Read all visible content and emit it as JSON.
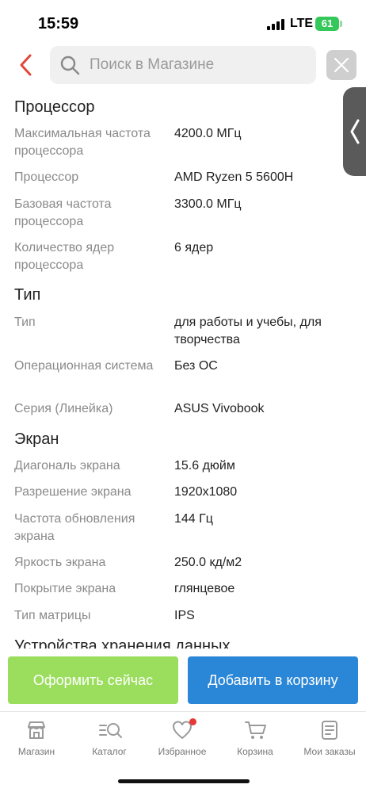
{
  "status_bar": {
    "time": "15:59",
    "network": "LTE",
    "battery": "61"
  },
  "search": {
    "placeholder": "Поиск в Магазине"
  },
  "sections": [
    {
      "title": "Процессор",
      "rows": [
        {
          "label": "Максимальная частота процессора",
          "value": "4200.0 МГц"
        },
        {
          "label": "Процессор",
          "value": "AMD Ryzen 5 5600H"
        },
        {
          "label": "Базовая частота процессора",
          "value": "3300.0 МГц"
        },
        {
          "label": "Количество ядер процессора",
          "value": "6 ядер"
        }
      ]
    },
    {
      "title": "Тип",
      "rows": [
        {
          "label": "Тип",
          "value": "для работы и учебы, для творчества"
        },
        {
          "label": "Операционная система",
          "value": "Без ОС"
        },
        {
          "label": "Серия (Линейка)",
          "value": "ASUS Vivobook"
        }
      ]
    },
    {
      "title": "Экран",
      "rows": [
        {
          "label": "Диагональ экрана",
          "value": "15.6 дюйм"
        },
        {
          "label": "Разрешение экрана",
          "value": "1920x1080"
        },
        {
          "label": "Частота обновления экрана",
          "value": "144 Гц"
        },
        {
          "label": "Яркость экрана",
          "value": "250.0 кд/м2"
        },
        {
          "label": "Покрытие экрана",
          "value": "глянцевое"
        },
        {
          "label": "Тип матрицы",
          "value": "IPS"
        }
      ]
    },
    {
      "title": "Устройства хранения данных",
      "rows": []
    }
  ],
  "actions": {
    "order_label": "Оформить сейчас",
    "cart_label": "Добавить в корзину"
  },
  "nav": {
    "items": [
      {
        "label": "Магазин",
        "icon": "store-icon"
      },
      {
        "label": "Каталог",
        "icon": "catalog-search-icon"
      },
      {
        "label": "Избранное",
        "icon": "heart-icon"
      },
      {
        "label": "Корзина",
        "icon": "cart-icon"
      },
      {
        "label": "Мои заказы",
        "icon": "orders-icon"
      }
    ]
  },
  "colors": {
    "accent_green": "#9bde5d",
    "accent_blue": "#2a86d6",
    "back_arrow": "#e0483a",
    "badge": "#e53935"
  }
}
